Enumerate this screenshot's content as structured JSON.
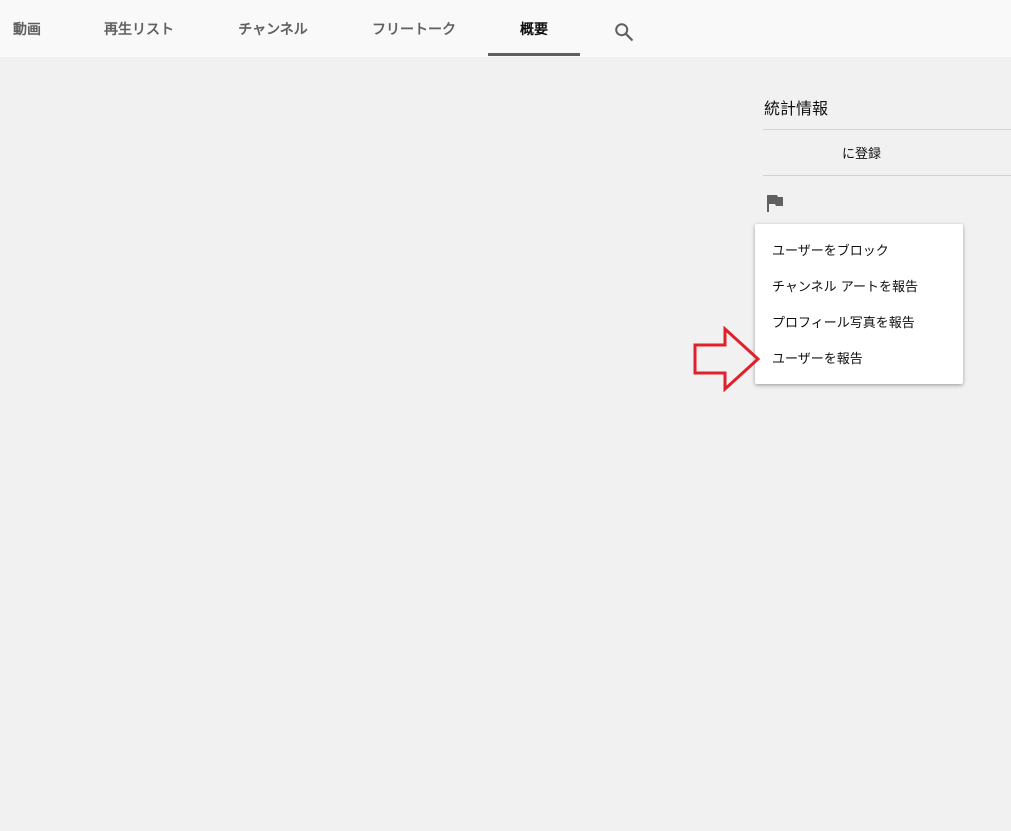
{
  "tabs": [
    {
      "label": "動画"
    },
    {
      "label": "再生リスト"
    },
    {
      "label": "チャンネル"
    },
    {
      "label": "フリートーク"
    },
    {
      "label": "概要"
    }
  ],
  "active_tab": "概要",
  "search": {
    "icon": "search-icon"
  },
  "stats": {
    "title": "統計情報",
    "registered_text": "に登録"
  },
  "report": {
    "icon": "flag-icon"
  },
  "menu": {
    "items": [
      {
        "label": "ユーザーをブロック"
      },
      {
        "label": "チャンネル アートを報告"
      },
      {
        "label": "プロフィール写真を報告"
      },
      {
        "label": "ユーザーを報告"
      }
    ]
  },
  "annotation": {
    "icon": "arrow-right-icon",
    "color": "#e0202a"
  },
  "colors": {
    "background": "#f1f1f1",
    "tabbar": "#f9f9f9",
    "tab_text": "#606060",
    "active_text": "#0f0f0f"
  }
}
